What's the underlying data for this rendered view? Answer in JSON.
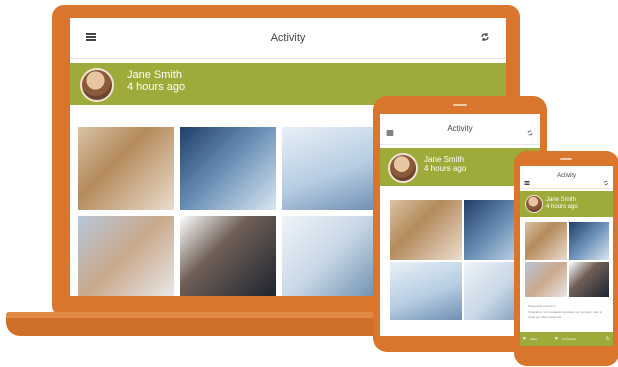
{
  "app": {
    "title": "Activity",
    "menu_icon": "menu-icon",
    "refresh_icon": "refresh-icon"
  },
  "post": {
    "user_name": "Jane Smith",
    "time_ago": "4 hours ago"
  },
  "phone_post": {
    "body_line1": "Pagamodit persolum",
    "body_line2": "Perspicium sint occaecat cupidatat non proident, sunt in",
    "body_line3": "culpa qui officia deserunt",
    "like_label": "Likes",
    "comment_label": "Comments"
  },
  "colors": {
    "device_orange": "#d9752c",
    "accent_green": "#9eaa3a"
  }
}
